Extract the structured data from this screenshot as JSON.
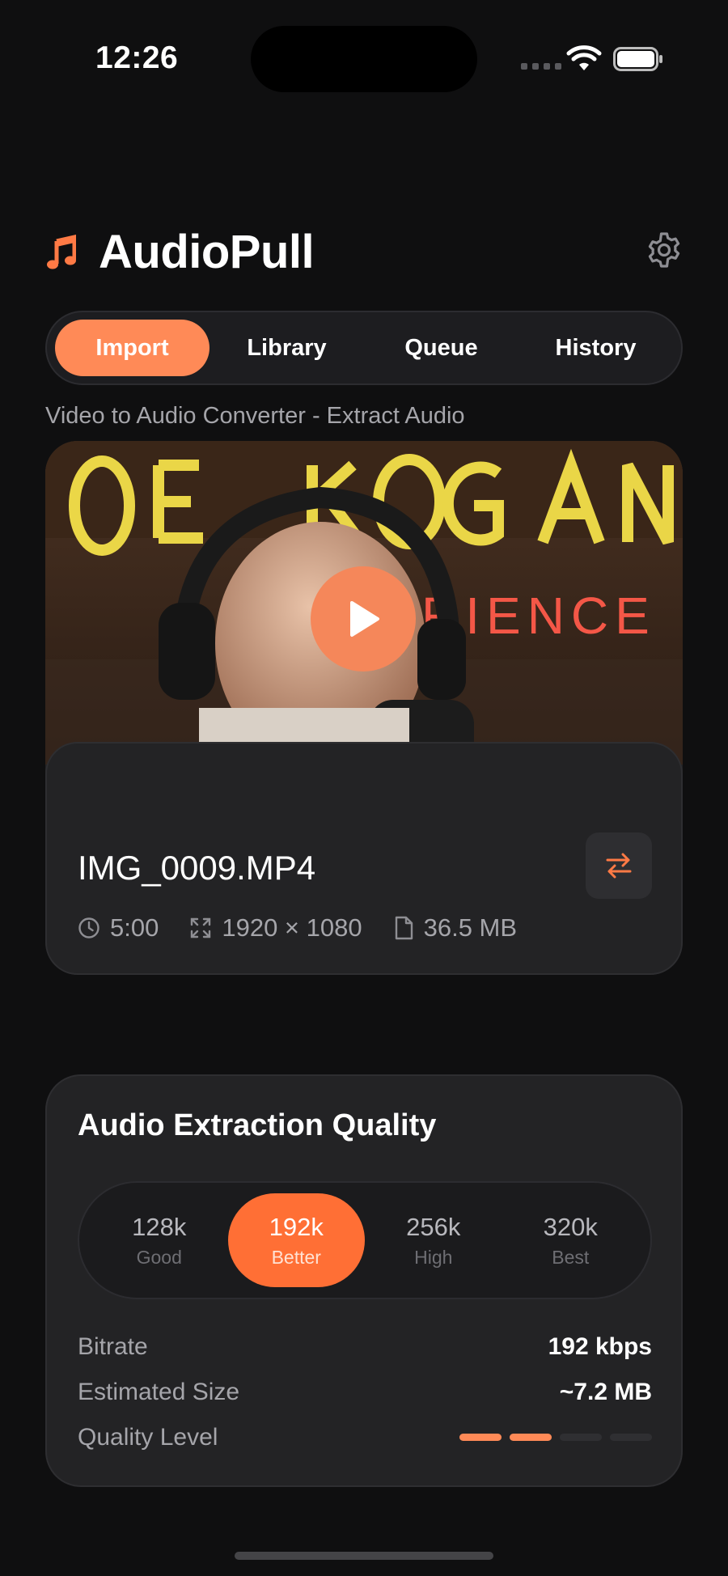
{
  "status_bar": {
    "time": "12:26"
  },
  "header": {
    "title": "AudioPull"
  },
  "tabs": [
    {
      "label": "Import",
      "active": true
    },
    {
      "label": "Library",
      "active": false
    },
    {
      "label": "Queue",
      "active": false
    },
    {
      "label": "History",
      "active": false
    }
  ],
  "subtitle": "Video to Audio Converter - Extract Audio",
  "video": {
    "filename": "IMG_0009.MP4",
    "duration": "5:00",
    "resolution": "1920 × 1080",
    "size": "36.5 MB"
  },
  "quality": {
    "title": "Audio Extraction Quality",
    "options": [
      {
        "value": "128k",
        "label": "Good",
        "active": false
      },
      {
        "value": "192k",
        "label": "Better",
        "active": true
      },
      {
        "value": "256k",
        "label": "High",
        "active": false
      },
      {
        "value": "320k",
        "label": "Best",
        "active": false
      }
    ],
    "bitrate_label": "Bitrate",
    "bitrate_value": "192 kbps",
    "estimated_size_label": "Estimated Size",
    "estimated_size_value": "~7.2 MB",
    "quality_level_label": "Quality Level",
    "quality_level": 2,
    "quality_level_max": 4
  },
  "colors": {
    "accent": "#ff6f35",
    "tab_active": "#ff8a57",
    "background": "#0f0f10",
    "card": "#232325"
  }
}
